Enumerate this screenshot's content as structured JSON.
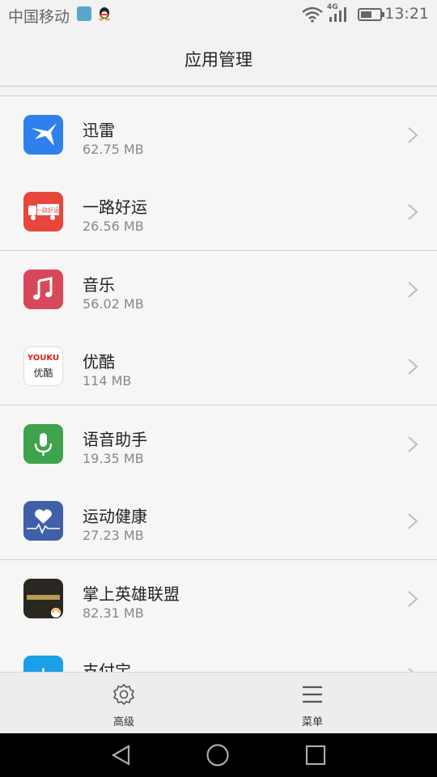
{
  "status_bar": {
    "carrier": "中国移动",
    "network": "4G",
    "time": "13:21"
  },
  "header": {
    "title": "应用管理"
  },
  "apps": [
    {
      "name": "迅雷",
      "size": "62.75 MB",
      "color": "#2f80ed",
      "icon": "thunder-bird-icon"
    },
    {
      "name": "一路好运",
      "size": "26.56 MB",
      "color": "#e8453c",
      "icon": "truck-icon",
      "icon_text": "一路好运"
    },
    {
      "name": "音乐",
      "size": "56.02 MB",
      "color": "#d9485a",
      "icon": "music-note-icon"
    },
    {
      "name": "优酷",
      "size": "114 MB",
      "color": "#ffffff",
      "icon": "youku-icon",
      "icon_text": "YOUKU",
      "icon_text2": "优酷"
    },
    {
      "name": "语音助手",
      "size": "19.35 MB",
      "color": "#3fa34d",
      "icon": "microphone-icon"
    },
    {
      "name": "运动健康",
      "size": "27.23 MB",
      "color": "#3f5fa8",
      "icon": "heart-pulse-icon"
    },
    {
      "name": "掌上英雄联盟",
      "size": "82.31 MB",
      "color": "#2a2620",
      "icon": "lol-icon"
    },
    {
      "name": "支付宝",
      "size": "",
      "color": "#1aa0e6",
      "icon": "alipay-icon",
      "icon_text": "支"
    }
  ],
  "bottom_bar": {
    "advanced_label": "高级",
    "menu_label": "菜单"
  }
}
